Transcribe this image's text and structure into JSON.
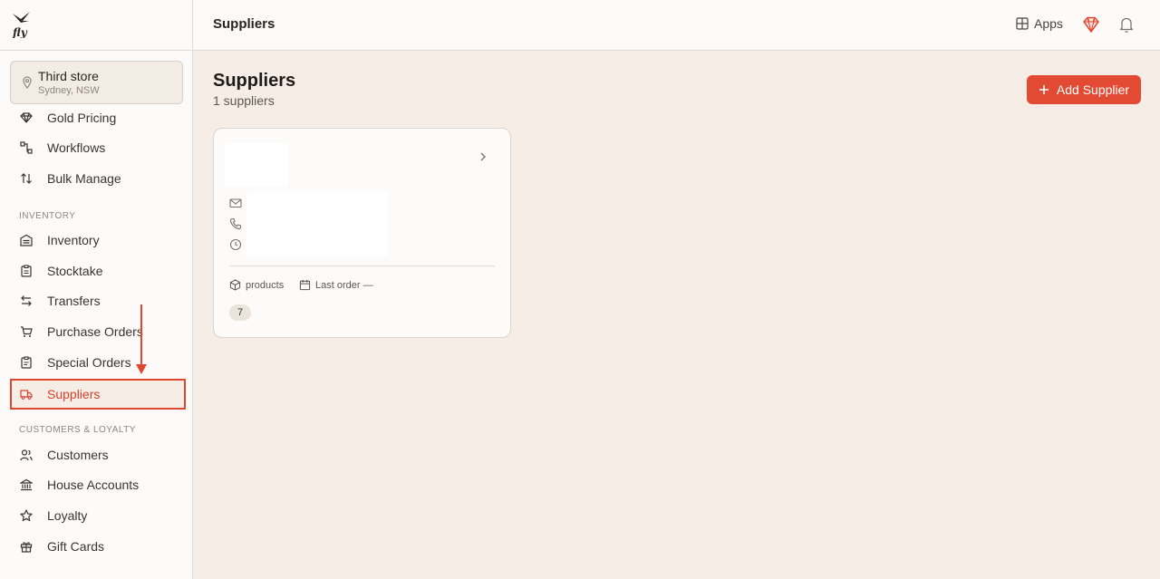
{
  "app": {
    "logo_text": "fly"
  },
  "store": {
    "name": "Third store",
    "location": "Sydney, NSW"
  },
  "nav": {
    "items_top": [
      {
        "label": "Gold Pricing",
        "icon": "gem-icon"
      },
      {
        "label": "Workflows",
        "icon": "workflow-icon"
      },
      {
        "label": "Bulk Manage",
        "icon": "sort-arrows-icon"
      }
    ],
    "section_inventory": "INVENTORY",
    "items_inventory": [
      {
        "label": "Inventory",
        "icon": "inventory-icon"
      },
      {
        "label": "Stocktake",
        "icon": "clipboard-icon"
      },
      {
        "label": "Transfers",
        "icon": "transfer-icon"
      },
      {
        "label": "Purchase Orders",
        "icon": "cart-icon"
      },
      {
        "label": "Special Orders",
        "icon": "clipboard-list-icon"
      },
      {
        "label": "Suppliers",
        "icon": "truck-icon",
        "active": true
      }
    ],
    "section_customers": "CUSTOMERS & LOYALTY",
    "items_customers": [
      {
        "label": "Customers",
        "icon": "users-icon"
      },
      {
        "label": "House Accounts",
        "icon": "bank-icon"
      },
      {
        "label": "Loyalty",
        "icon": "star-icon"
      },
      {
        "label": "Gift Cards",
        "icon": "gift-icon"
      }
    ]
  },
  "header": {
    "title": "Suppliers",
    "apps_label": "Apps"
  },
  "main": {
    "title": "Suppliers",
    "subtitle": "1 suppliers",
    "add_button_label": "Add Supplier"
  },
  "supplier_card": {
    "products_label": "products",
    "last_order_label": "Last order —",
    "product_count": "7"
  },
  "colors": {
    "accent": "#e34a33",
    "background": "#f5ede6",
    "sidebar": "#fcfbf9"
  }
}
